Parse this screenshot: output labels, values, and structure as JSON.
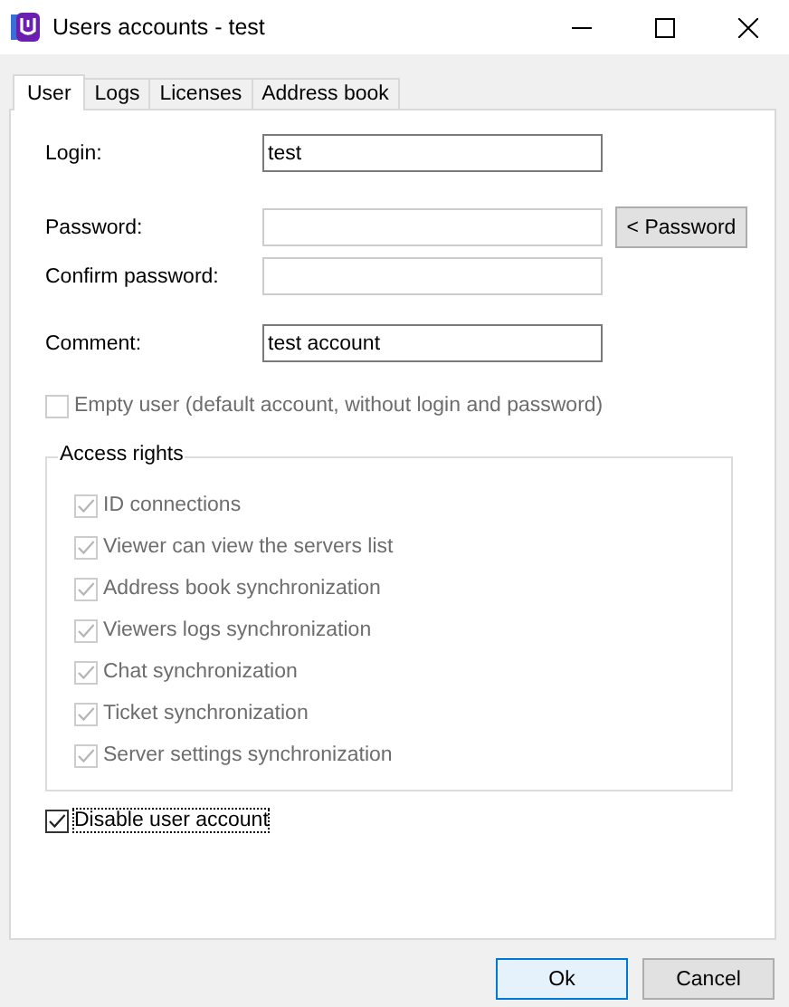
{
  "window": {
    "title": "Users accounts - test"
  },
  "tabs": [
    {
      "label": "User",
      "selected": true
    },
    {
      "label": "Logs",
      "selected": false
    },
    {
      "label": "Licenses",
      "selected": false
    },
    {
      "label": "Address book",
      "selected": false
    }
  ],
  "fields": [
    {
      "label": "Login:",
      "value": "test",
      "disabled": false
    },
    {
      "label": "Password:",
      "disabled": true,
      "button": "< Password"
    },
    {
      "label": "Confirm password:",
      "disabled": true
    },
    {
      "label": "Comment:",
      "value": "test account",
      "disabled": false
    }
  ],
  "empty_user": {
    "label": "Empty user (default account, without login and password)",
    "checked": false,
    "disabled": true
  },
  "access_rights": {
    "title": "Access rights",
    "items": [
      {
        "label": "ID connections",
        "checked": true,
        "disabled": true
      },
      {
        "label": "Viewer can view the servers list",
        "checked": true,
        "disabled": true
      },
      {
        "label": "Address book synchronization",
        "checked": true,
        "disabled": true
      },
      {
        "label": "Viewers logs synchronization",
        "checked": true,
        "disabled": true
      },
      {
        "label": "Chat synchronization",
        "checked": true,
        "disabled": true
      },
      {
        "label": "Ticket synchronization",
        "checked": true,
        "disabled": true
      },
      {
        "label": "Server settings synchronization",
        "checked": true,
        "disabled": true
      }
    ]
  },
  "disable_account": {
    "label": "Disable user account",
    "checked": true,
    "disabled": false
  },
  "buttons": [
    {
      "label": "Ok",
      "default": true
    },
    {
      "label": "Cancel",
      "default": false
    }
  ]
}
